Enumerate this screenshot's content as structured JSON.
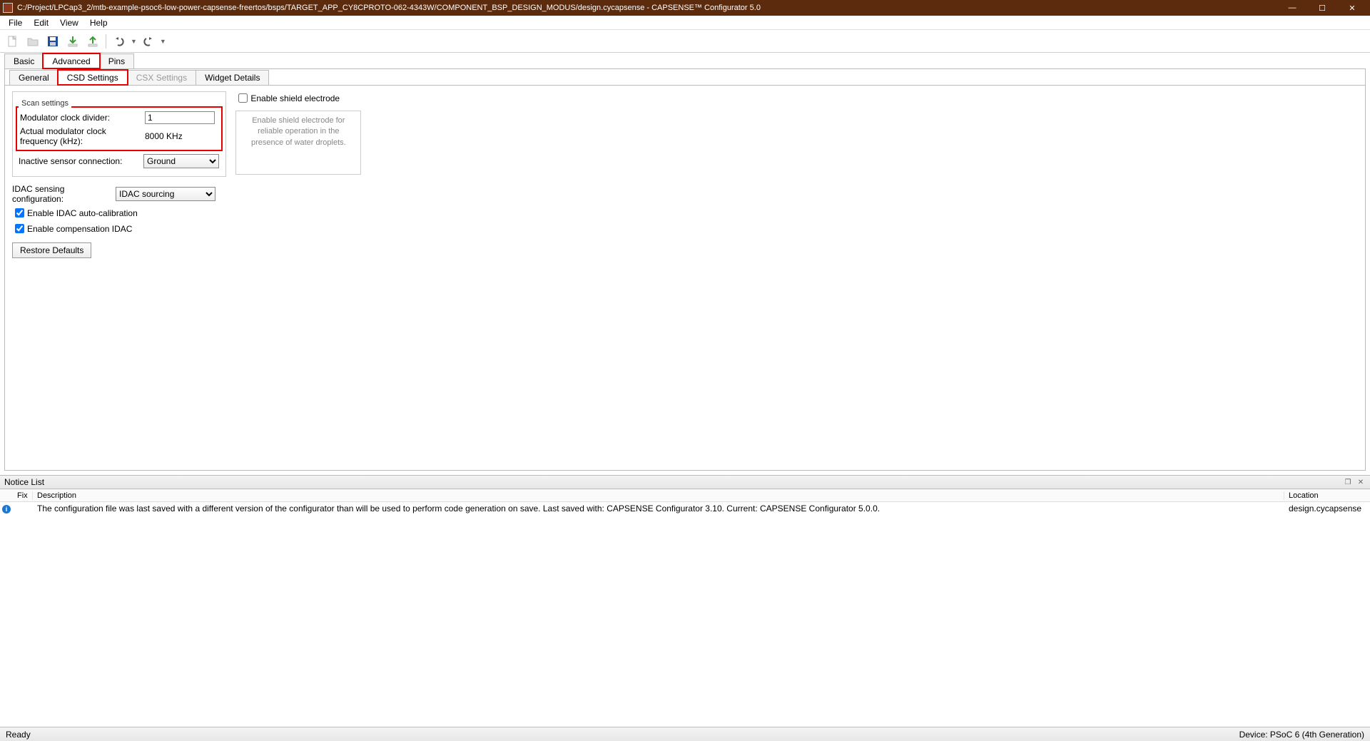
{
  "window": {
    "title": "C:/Project/LPCap3_2/mtb-example-psoc6-low-power-capsense-freertos/bsps/TARGET_APP_CY8CPROTO-062-4343W/COMPONENT_BSP_DESIGN_MODUS/design.cycapsense - CAPSENSE™ Configurator 5.0"
  },
  "menu": {
    "file": "File",
    "edit": "Edit",
    "view": "View",
    "help": "Help"
  },
  "maintabs": {
    "basic": "Basic",
    "advanced": "Advanced",
    "pins": "Pins"
  },
  "subtabs": {
    "general": "General",
    "csd": "CSD Settings",
    "csx": "CSX Settings",
    "widget": "Widget Details"
  },
  "scan": {
    "title": "Scan settings",
    "mod_div_label": "Modulator clock divider:",
    "mod_div_value": "1",
    "actual_freq_label": "Actual modulator clock frequency (kHz):",
    "actual_freq_value": "8000 KHz",
    "inactive_label": "Inactive sensor connection:",
    "inactive_value": "Ground"
  },
  "idac": {
    "sensing_label": "IDAC sensing configuration:",
    "sensing_value": "IDAC sourcing",
    "auto_cal": "Enable IDAC auto-calibration",
    "comp": "Enable compensation IDAC"
  },
  "restore": "Restore Defaults",
  "shield": {
    "enable": "Enable shield electrode",
    "desc": "Enable shield electrode for reliable operation in the presence of water droplets."
  },
  "notice": {
    "title": "Notice List",
    "cols": {
      "fix": "Fix",
      "desc": "Description",
      "loc": "Location"
    },
    "row": {
      "desc": "The configuration file was last saved with a different version of the configurator than will be used to perform code generation on save. Last saved with: CAPSENSE Configurator 3.10. Current: CAPSENSE Configurator 5.0.0.",
      "loc": "design.cycapsense"
    }
  },
  "status": {
    "ready": "Ready",
    "device": "Device: PSoC 6 (4th Generation)"
  }
}
